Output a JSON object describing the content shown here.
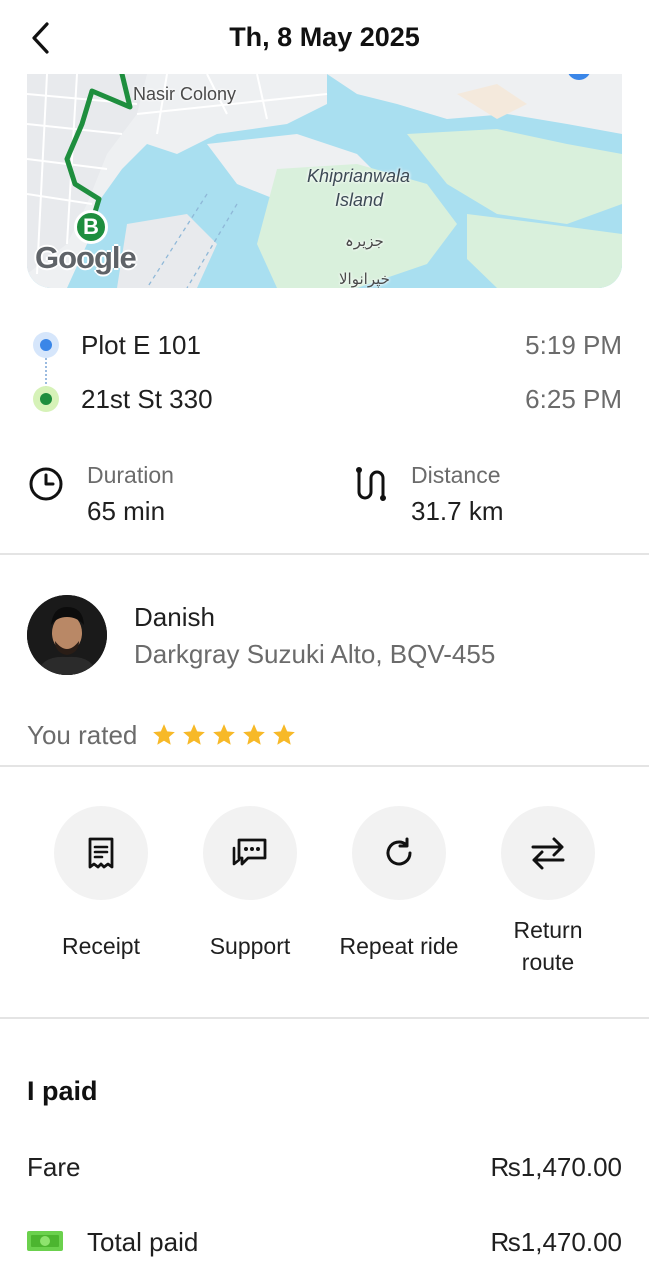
{
  "header": {
    "title": "Th, 8 May 2025",
    "back_icon": "chevron-left-icon"
  },
  "map": {
    "labels": {
      "nasir_colony": "Nasir Colony",
      "island_line1": "Khiprianwala",
      "island_line2": "Island",
      "urdu_1": "جزیرہ",
      "urdu_2": "خپرانوالا"
    },
    "marker_b": "B",
    "attribution": "Google",
    "route_color": "#1e8e3e",
    "water_color": "#a9dff0",
    "land_color": "#d9f0dc"
  },
  "trip": {
    "pickup": {
      "name": "Plot E 101",
      "time": "5:19 PM"
    },
    "dropoff": {
      "name": "21st St 330",
      "time": "6:25 PM"
    }
  },
  "stats": {
    "duration": {
      "label": "Duration",
      "value": "65 min",
      "icon": "clock-icon"
    },
    "distance": {
      "label": "Distance",
      "value": "31.7 km",
      "icon": "route-icon"
    }
  },
  "driver": {
    "name": "Danish",
    "vehicle": "Darkgray Suzuki Alto, BQV-455"
  },
  "rating": {
    "label": "You rated",
    "stars": 5,
    "max_stars": 5,
    "star_color": "#f7b928"
  },
  "actions": [
    {
      "label": "Receipt",
      "icon": "receipt-icon"
    },
    {
      "label": "Support",
      "icon": "chat-bubble-icon"
    },
    {
      "label": "Repeat ride",
      "icon": "refresh-icon"
    },
    {
      "label": "Return route",
      "icon": "swap-arrows-icon"
    }
  ],
  "payment": {
    "title": "I paid",
    "fare": {
      "label": "Fare",
      "value": "₨1,470.00"
    },
    "total": {
      "label": "Total paid",
      "value": "₨1,470.00",
      "icon": "cash-icon"
    }
  }
}
